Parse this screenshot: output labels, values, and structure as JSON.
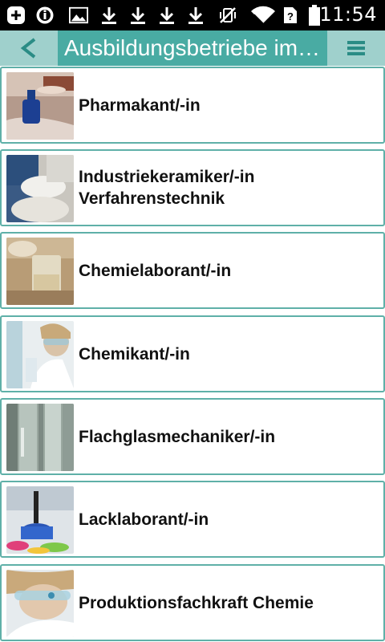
{
  "status_bar": {
    "time": "11:54",
    "icons": [
      "plus-icon",
      "info-icon",
      "image-icon",
      "download-icon",
      "download-icon",
      "download-icon",
      "download-icon",
      "vibrate-off-icon",
      "wifi-icon",
      "sim-unknown-icon",
      "battery-icon"
    ]
  },
  "action_bar": {
    "back_label": "<",
    "title": "Ausbildungsbetriebe im…",
    "menu_icon": "menu-icon",
    "colors": {
      "bar": "#9fd0cc",
      "title_bg": "#49aba3",
      "accent": "#5fb0a8"
    }
  },
  "list": {
    "items": [
      {
        "line1": "Pharmakant/-in",
        "line2": ""
      },
      {
        "line1": "Industriekeramiker/-in",
        "line2": "Verfahrenstechnik"
      },
      {
        "line1": "Chemielaborant/-in",
        "line2": ""
      },
      {
        "line1": "Chemikant/-in",
        "line2": ""
      },
      {
        "line1": "Flachglasmechaniker/-in",
        "line2": ""
      },
      {
        "line1": "Lacklaborant/-in",
        "line2": ""
      },
      {
        "line1": "Produktionsfachkraft Chemie",
        "line2": ""
      }
    ]
  }
}
